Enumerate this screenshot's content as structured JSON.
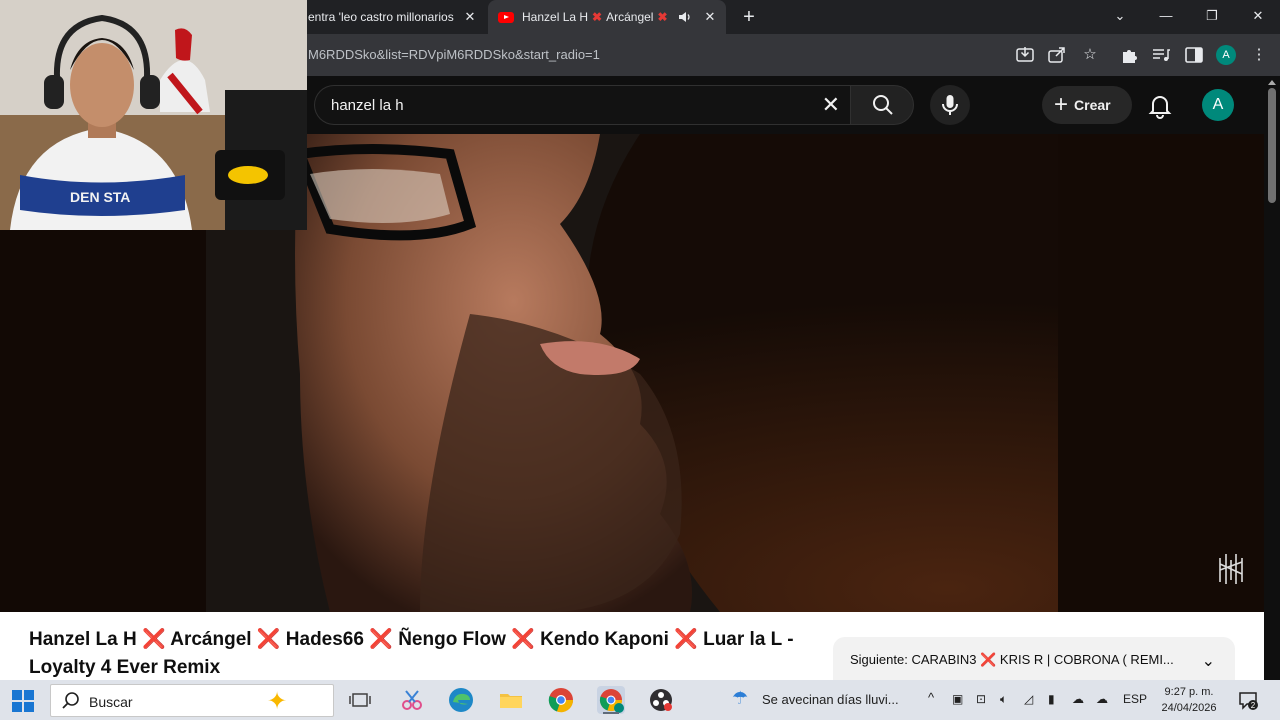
{
  "browser": {
    "tabs": [
      {
        "title": "entra 'leo castro millonarios",
        "active": false
      },
      {
        "title_parts": [
          "Hanzel La H",
          "Arcángel"
        ],
        "active": true,
        "muted_icon": "speaker-icon"
      }
    ],
    "url": "M6RDDSko&list=RDVpiM6RDDSko&start_radio=1",
    "profile_initial": "A"
  },
  "youtube": {
    "search_value": "hanzel la h",
    "create_label": "Crear",
    "avatar_initial": "A",
    "video_title_parts": [
      "Hanzel La H",
      "Arcángel",
      "Hades66",
      "Ñengo Flow",
      "Kendo Kaponi",
      "Luar la L -"
    ],
    "video_title_line2": "Loyalty 4 Ever Remix",
    "next_label": "Siguiente:",
    "next_title_parts": [
      "CARABIN3",
      "KRIS R | COBRONA ( REMI..."
    ]
  },
  "taskbar": {
    "search_placeholder": "Buscar",
    "weather": "Se avecinan días lluvi...",
    "language": "ESP",
    "time": "9:27 p. m.",
    "date": "24/04/2026",
    "notification_count": "2"
  },
  "colors": {
    "tab_bar": "#202124",
    "address_bar": "#35363a",
    "yt_bg": "#0f0f0f",
    "accent_red": "#e53935",
    "avatar_teal": "#00897b"
  }
}
